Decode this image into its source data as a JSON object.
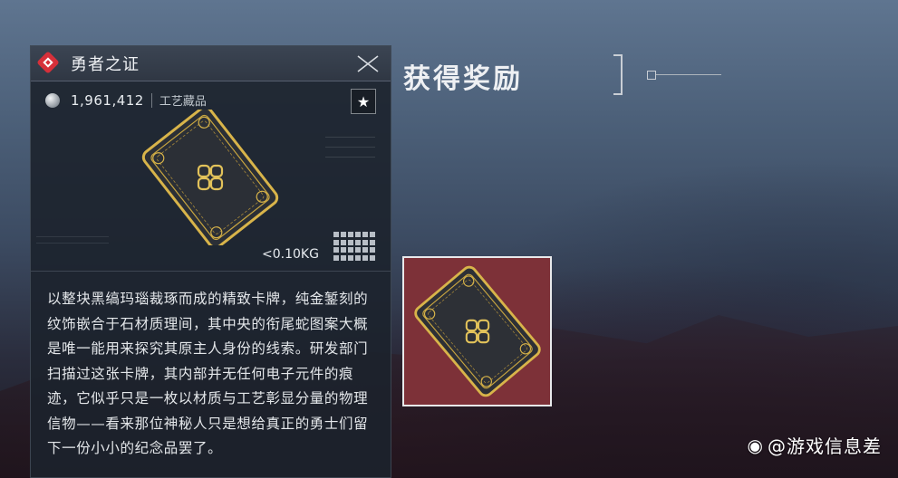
{
  "item_panel": {
    "name": "勇者之证",
    "price": "1,961,412",
    "category": "工艺藏品",
    "weight": "<0.10KG",
    "description": "以整块黑缟玛瑙裁琢而成的精致卡牌，纯金錾刻的纹饰嵌合于石材质理间，其中央的衔尾蛇图案大概是唯一能用来探究其原主人身份的线索。研发部门扫描过这张卡牌，其内部并无任何电子元件的痕迹，它似乎只是一枚以材质与工艺彰显分量的物理信物——看来那位神秘人只是想给真正的勇士们留下一份小小的纪念品罢了。",
    "icons": {
      "rarity": "red-diamond-icon",
      "close": "close-x-icon",
      "currency": "silver-coin-icon",
      "favorite": "star-icon",
      "size_grid": "inventory-grid-icon"
    },
    "colors": {
      "rarity": "#d6303a",
      "gold": "#d8b44a"
    }
  },
  "reward": {
    "title": "获得奖励",
    "slot_background": "#7d3138"
  },
  "watermark": {
    "icon": "weibo-icon",
    "text": "@游戏信息差"
  }
}
